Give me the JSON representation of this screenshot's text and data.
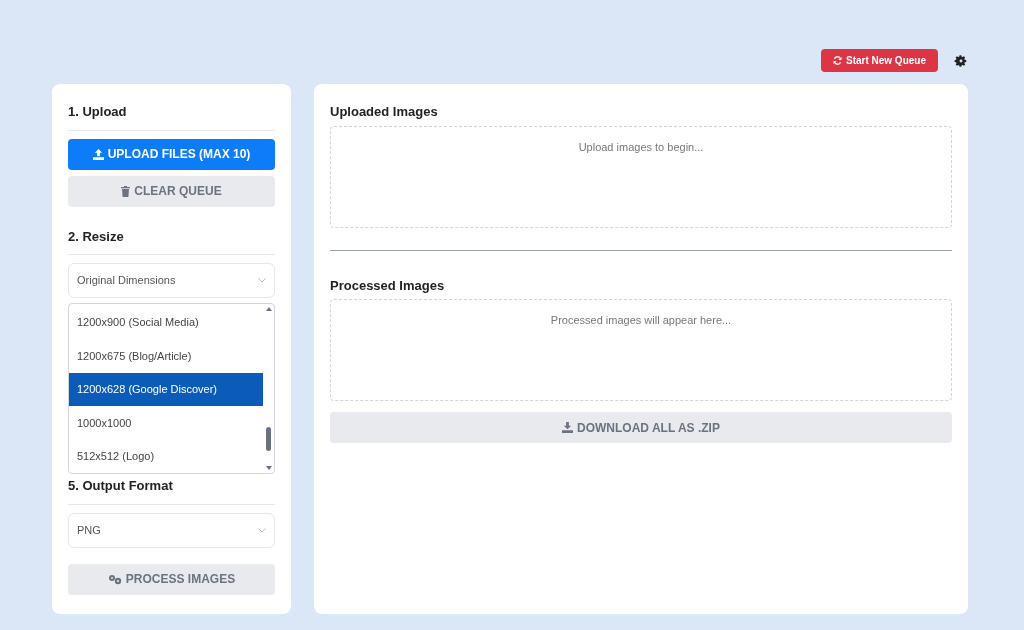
{
  "header": {
    "new_queue_button": "Start New Queue"
  },
  "sidebar": {
    "upload": {
      "title": "1. Upload",
      "upload_button": "UPLOAD FILES (MAX 10)",
      "clear_button": "CLEAR QUEUE"
    },
    "resize": {
      "title": "2. Resize",
      "select_value": "Original Dimensions",
      "options": [
        {
          "label": "1200x900 (Social Media)",
          "selected": false
        },
        {
          "label": "1200x675 (Blog/Article)",
          "selected": false
        },
        {
          "label": "1200x628 (Google Discover)",
          "selected": true
        },
        {
          "label": "1000x1000",
          "selected": false
        },
        {
          "label": "512x512 (Logo)",
          "selected": false
        }
      ]
    },
    "output": {
      "title": "5. Output Format",
      "select_value": "PNG"
    },
    "process_button": "PROCESS IMAGES"
  },
  "main": {
    "uploaded": {
      "title": "Uploaded Images",
      "placeholder": "Upload images to begin..."
    },
    "processed": {
      "title": "Processed Images",
      "placeholder": "Processed images will appear here..."
    },
    "download_button": "DOWNLOAD ALL AS .ZIP"
  }
}
